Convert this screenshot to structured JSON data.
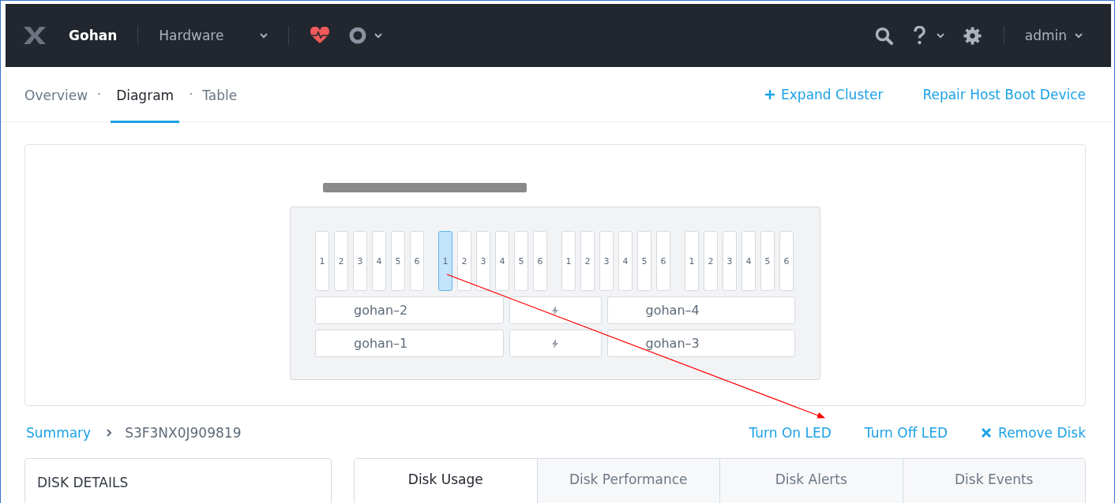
{
  "top_bar": {
    "cluster": "Gohan",
    "section": "Hardware",
    "user": "admin"
  },
  "view_tabs": [
    {
      "label": "Overview",
      "selected": false
    },
    {
      "label": "Diagram",
      "selected": true
    },
    {
      "label": "Table",
      "selected": false
    }
  ],
  "view_separators": [
    "·",
    "·"
  ],
  "actions": {
    "expand": "Expand Cluster",
    "repair": "Repair Host Boot Device"
  },
  "chassis": {
    "disk_groups": [
      {
        "disks": [
          {
            "label": "1",
            "selected": false
          },
          {
            "label": "2",
            "selected": false
          },
          {
            "label": "3",
            "selected": false
          },
          {
            "label": "4",
            "selected": false
          },
          {
            "label": "5",
            "selected": false
          },
          {
            "label": "6",
            "selected": false
          }
        ]
      },
      {
        "disks": [
          {
            "label": "1",
            "selected": true
          },
          {
            "label": "2",
            "selected": false
          },
          {
            "label": "3",
            "selected": false
          },
          {
            "label": "4",
            "selected": false
          },
          {
            "label": "5",
            "selected": false
          },
          {
            "label": "6",
            "selected": false
          }
        ]
      },
      {
        "disks": [
          {
            "label": "1",
            "selected": false
          },
          {
            "label": "2",
            "selected": false
          },
          {
            "label": "3",
            "selected": false
          },
          {
            "label": "4",
            "selected": false
          },
          {
            "label": "5",
            "selected": false
          },
          {
            "label": "6",
            "selected": false
          }
        ]
      },
      {
        "disks": [
          {
            "label": "1",
            "selected": false
          },
          {
            "label": "2",
            "selected": false
          },
          {
            "label": "3",
            "selected": false
          },
          {
            "label": "4",
            "selected": false
          },
          {
            "label": "5",
            "selected": false
          },
          {
            "label": "6",
            "selected": false
          }
        ]
      }
    ],
    "node_rows": [
      {
        "left": "gohan–2",
        "right": "gohan–4"
      },
      {
        "left": "gohan–1",
        "right": "gohan–3"
      }
    ]
  },
  "breadcrumb": {
    "parent": "Summary",
    "current": "S3F3NX0J909819"
  },
  "disk_actions": {
    "led_on": "Turn On LED",
    "led_off": "Turn Off LED",
    "remove": "Remove Disk"
  },
  "details_panel": {
    "title": "DISK DETAILS"
  },
  "disk_tabs": [
    {
      "label": "Disk Usage",
      "selected": true
    },
    {
      "label": "Disk Performance",
      "selected": false
    },
    {
      "label": "Disk Alerts",
      "selected": false
    },
    {
      "label": "Disk Events",
      "selected": false
    }
  ]
}
